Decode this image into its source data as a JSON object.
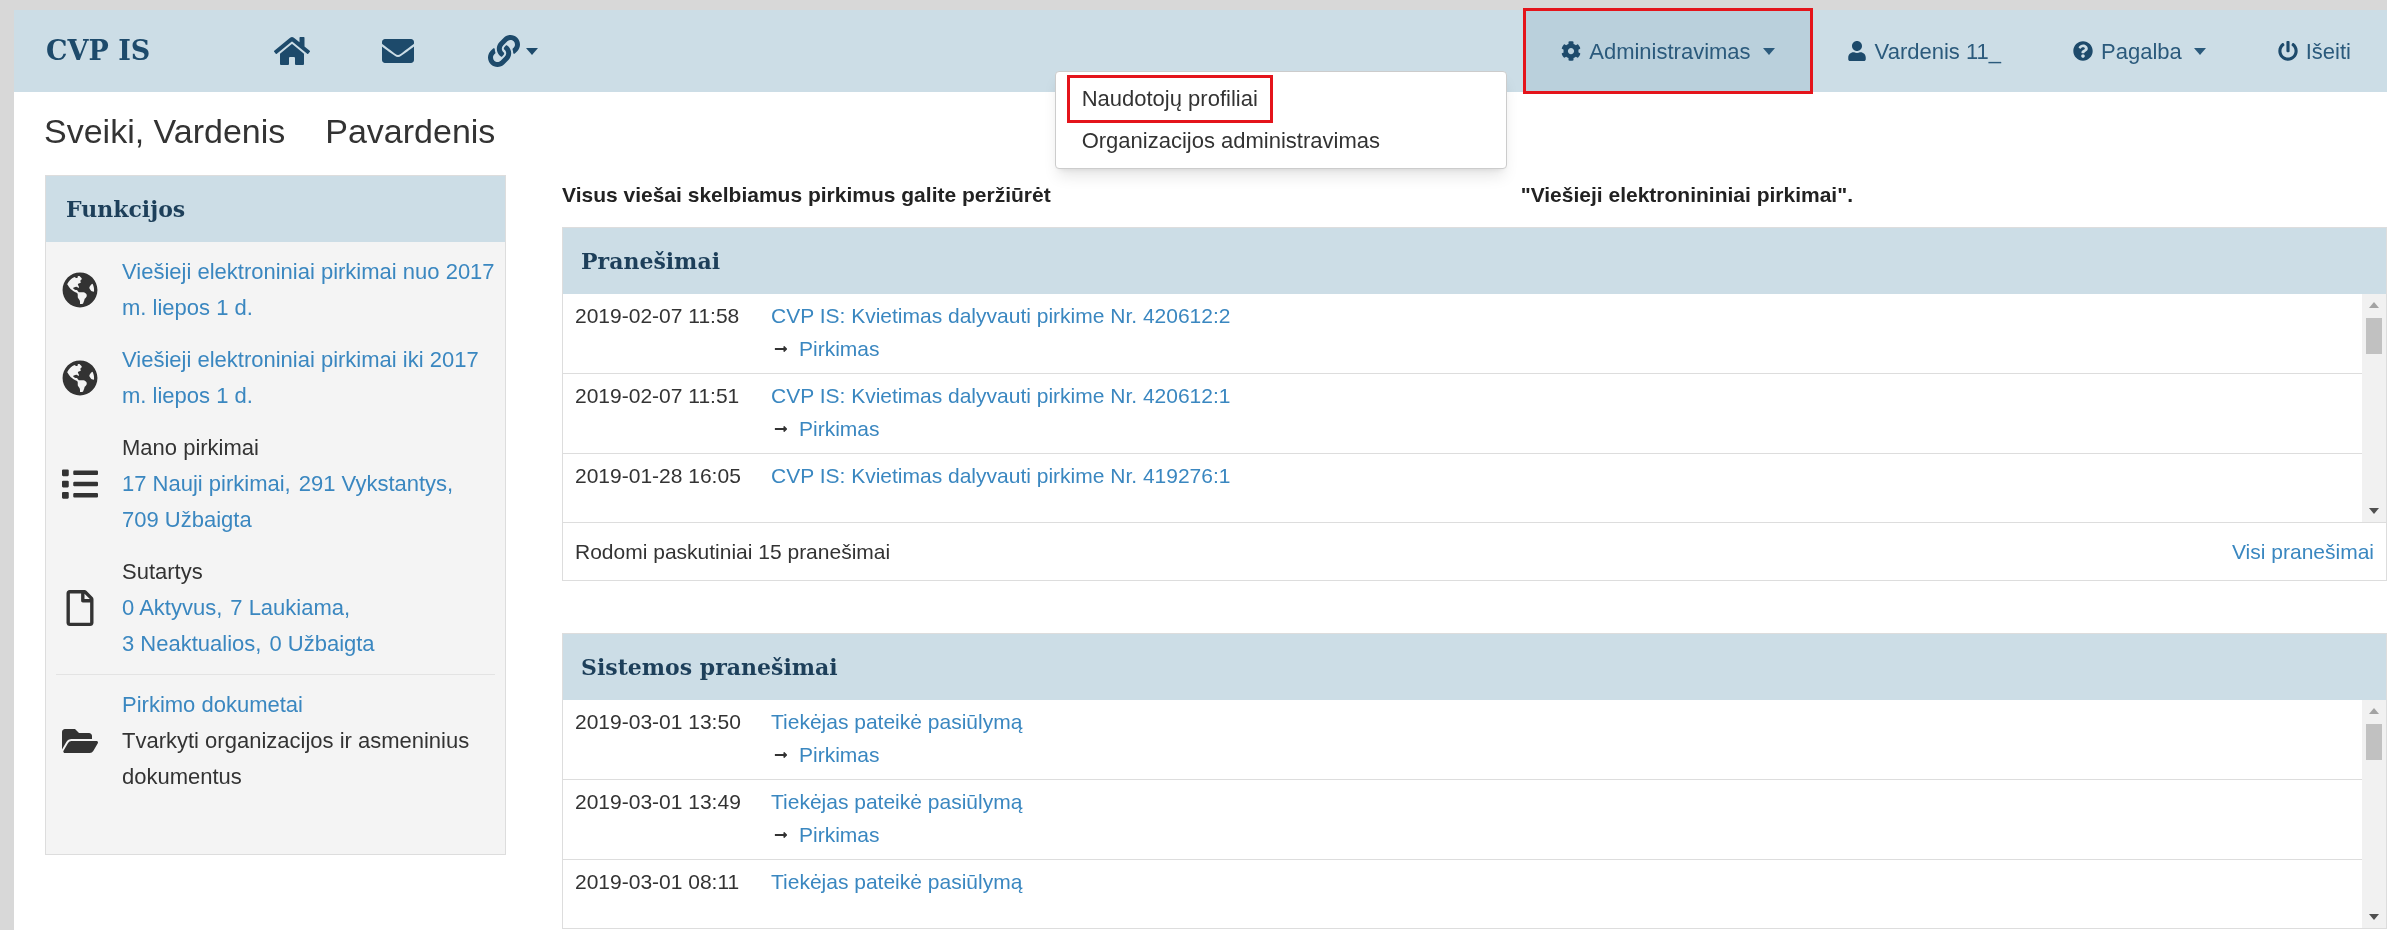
{
  "navbar": {
    "brand": "CVP IS",
    "icons": [
      {
        "kind": "home"
      },
      {
        "kind": "mail"
      },
      {
        "kind": "link",
        "caret": true
      }
    ],
    "right": [
      {
        "kind": "admin",
        "label": "Administravimas",
        "caret": true,
        "highlighted": true
      },
      {
        "kind": "user",
        "label": "Vardenis 11_",
        "caret": false,
        "highlighted": false
      },
      {
        "kind": "help",
        "label": "Pagalba",
        "caret": true,
        "highlighted": false
      },
      {
        "kind": "logout",
        "label": "Išeiti",
        "caret": false,
        "highlighted": false
      }
    ]
  },
  "dropdown": {
    "items": [
      {
        "label": "Naudotojų profiliai",
        "highlighted": true
      },
      {
        "label": "Organizacijos administravimas",
        "highlighted": false
      }
    ]
  },
  "greeting": {
    "first": "Sveiki, Vardenis",
    "last": "Pavardenis"
  },
  "sidebar": {
    "title": "Funkcijos",
    "items": [
      {
        "kind": "link",
        "link": "Viešieji elektroniniai pirkimai nuo 2017 m. liepos 1 d."
      },
      {
        "kind": "link",
        "link": "Viešieji elektroniniai pirkimai iki 2017 m. liepos 1 d."
      },
      {
        "kind": "group",
        "title": "Mano pirkimai",
        "links": [
          "17 Nauji pirkimai,",
          "291 Vykstantys,",
          "709 Užbaigta"
        ]
      },
      {
        "kind": "group",
        "title": "Sutartys",
        "links": [
          "0 Aktyvus,",
          "7 Laukiama,",
          "3 Neaktualios,",
          "0 Užbaigta"
        ]
      },
      {
        "kind": "document",
        "link": "Pirkimo dokumetai",
        "text": "Tvarkyti organizacijos ir asmeninius dokumentus"
      }
    ]
  },
  "intro": {
    "start": "Visus viešai skelbiamus pirkimus galite peržiūrėt",
    "end": "\"Viešieji elektronininiai pirkimai\"."
  },
  "panels": [
    {
      "title": "Pranešimai",
      "rows": [
        {
          "time": "2019-02-07 11:58",
          "message": "CVP IS: Kvietimas dalyvauti pirkime Nr. 420612:2",
          "link": "Pirkimas"
        },
        {
          "time": "2019-02-07 11:51",
          "message": "CVP IS: Kvietimas dalyvauti pirkime Nr. 420612:1",
          "link": "Pirkimas"
        },
        {
          "time": "2019-01-28 16:05",
          "message": "CVP IS: Kvietimas dalyvauti pirkime Nr. 419276:1"
        }
      ],
      "footer": {
        "text": "Rodomi paskutiniai 15 pranešimai",
        "link": "Visi pranešimai"
      }
    },
    {
      "title": "Sistemos pranešimai",
      "rows": [
        {
          "time": "2019-03-01 13:50",
          "message": "Tiekėjas pateikė pasiūlymą",
          "link": "Pirkimas"
        },
        {
          "time": "2019-03-01 13:49",
          "message": "Tiekėjas pateikė pasiūlymą",
          "link": "Pirkimas"
        },
        {
          "time": "2019-03-01 08:11",
          "message": "Tiekėjas pateikė pasiūlymą"
        }
      ]
    }
  ]
}
